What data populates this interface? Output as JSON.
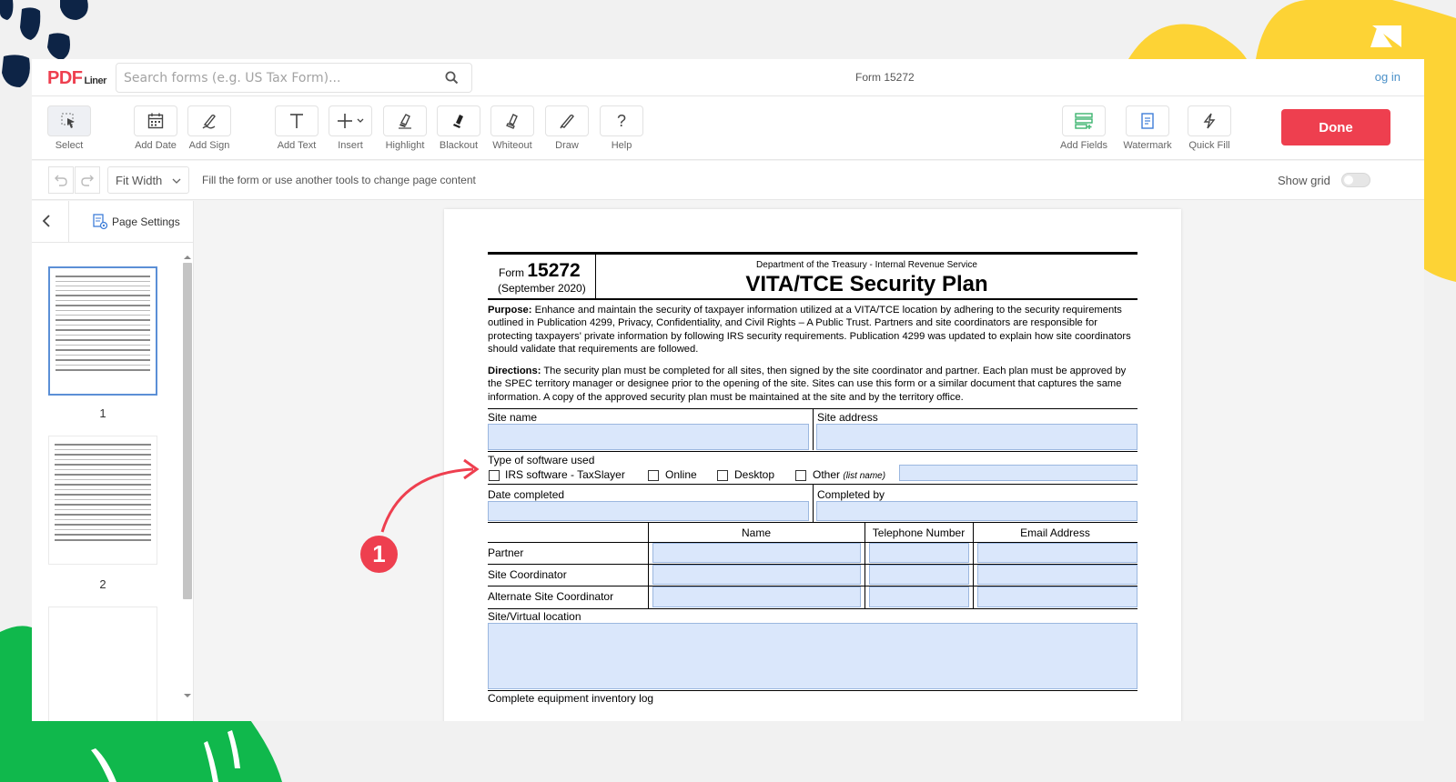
{
  "header": {
    "logo_main": "PDF",
    "logo_sub": "Liner",
    "search_placeholder": "Search forms (e.g. US Tax Form)...",
    "document_title": "Form 15272",
    "login_label": "og in"
  },
  "toolbar": {
    "tools": [
      {
        "label": "Select"
      },
      {
        "label": "Add Date"
      },
      {
        "label": "Add Sign"
      },
      {
        "label": "Add Text"
      },
      {
        "label": "Insert"
      },
      {
        "label": "Highlight"
      },
      {
        "label": "Blackout"
      },
      {
        "label": "Whiteout"
      },
      {
        "label": "Draw"
      },
      {
        "label": "Help"
      }
    ],
    "right_tools": [
      {
        "label": "Add Fields"
      },
      {
        "label": "Watermark"
      },
      {
        "label": "Quick Fill"
      }
    ],
    "done_label": "Done"
  },
  "subbar": {
    "zoom_value": "Fit Width",
    "hint": "Fill the form or use another tools to change page content",
    "show_grid_label": "Show grid",
    "show_grid_on": false
  },
  "sidebar": {
    "page_settings_label": "Page Settings",
    "pages": [
      "1",
      "2"
    ]
  },
  "form": {
    "form_word": "Form",
    "form_number": "15272",
    "form_date": "(September 2020)",
    "department": "Department of the Treasury - Internal Revenue Service",
    "title": "VITA/TCE Security Plan",
    "purpose_label": "Purpose:",
    "purpose_text": " Enhance and maintain the security of taxpayer information utilized at a VITA/TCE location by adhering to the security requirements outlined in Publication 4299, Privacy, Confidentiality, and Civil Rights – A Public Trust. Partners and site coordinators are responsible for protecting taxpayers' private information by following IRS security requirements. Publication 4299 was updated to explain how site coordinators should validate that requirements are followed.",
    "directions_label": "Directions:",
    "directions_text": " The security plan must be completed for all sites, then signed by the site coordinator and partner. Each plan must be approved by the SPEC territory manager or designee prior to the opening of the site. Sites can use this form or a similar document that captures the same information. A copy of the approved security plan must be maintained at the site and by the territory office.",
    "site_name_label": "Site name",
    "site_address_label": "Site address",
    "software_label": "Type of software used",
    "software_options": [
      "IRS software - TaxSlayer",
      "Online",
      "Desktop",
      "Other"
    ],
    "other_hint": "(list name)",
    "date_completed_label": "Date completed",
    "completed_by_label": "Completed by",
    "table_headers": [
      "Name",
      "Telephone Number",
      "Email Address"
    ],
    "table_rows": [
      "Partner",
      "Site Coordinator",
      "Alternate Site Coordinator"
    ],
    "location_label": "Site/Virtual location",
    "inventory_label": "Complete equipment inventory log"
  },
  "annotation": {
    "step_number": "1"
  },
  "colors": {
    "brand_red": "#ee3f4f",
    "field_fill": "#dae7fb",
    "deco_yellow": "#fdd335",
    "deco_green": "#10b84c",
    "deco_navy": "#0d2446"
  }
}
